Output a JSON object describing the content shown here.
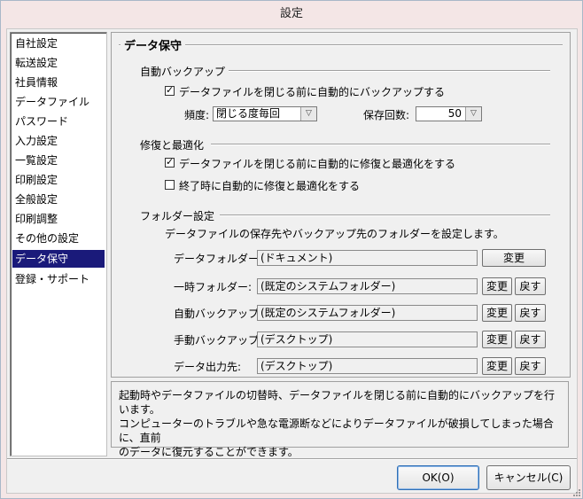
{
  "window": {
    "title": "設定"
  },
  "nav": {
    "items": [
      {
        "label": "自社設定"
      },
      {
        "label": "転送設定"
      },
      {
        "label": "社員情報"
      },
      {
        "label": "データファイル"
      },
      {
        "label": "パスワード"
      },
      {
        "label": "入力設定"
      },
      {
        "label": "一覧設定"
      },
      {
        "label": "印刷設定"
      },
      {
        "label": "全般設定"
      },
      {
        "label": "印刷調整"
      },
      {
        "label": "その他の設定"
      },
      {
        "label": "データ保守",
        "selected": true
      },
      {
        "label": "登録・サポート"
      }
    ]
  },
  "panel": {
    "title": "データ保守",
    "auto_backup": {
      "heading": "自動バックアップ",
      "checkbox_label": "データファイルを閉じる前に自動的にバックアップする",
      "checked": true,
      "frequency_label": "頻度:",
      "frequency_value": "閉じる度毎回",
      "retention_label": "保存回数:",
      "retention_value": "50"
    },
    "repair": {
      "heading": "修復と最適化",
      "option1_label": "データファイルを閉じる前に自動的に修復と最適化をする",
      "option1_checked": true,
      "option2_label": "終了時に自動的に修復と最適化をする",
      "option2_checked": false
    },
    "folders": {
      "heading": "フォルダー設定",
      "description": "データファイルの保存先やバックアップ先のフォルダーを設定します。",
      "change_label": "変更",
      "reset_label": "戻す",
      "rows": [
        {
          "label": "データフォルダー:",
          "value": "(ドキュメント)"
        },
        {
          "label": "一時フォルダー:",
          "value": "(既定のシステムフォルダー)"
        },
        {
          "label": "自動バックアップ:",
          "value": "(既定のシステムフォルダー)"
        },
        {
          "label": "手動バックアップ:",
          "value": "(デスクトップ)"
        },
        {
          "label": "データ出力先:",
          "value": "(デスクトップ)"
        }
      ]
    }
  },
  "description_box": {
    "line1": "起動時やデータファイルの切替時、データファイルを閉じる前に自動的にバックアップを行います。",
    "line2": "コンピューターのトラブルや急な電源断などによりデータファイルが破損してしまった場合に、直前",
    "line3": "のデータに復元することができます。"
  },
  "buttons": {
    "ok": "OK(O)",
    "cancel": "キャンセル(C)"
  }
}
